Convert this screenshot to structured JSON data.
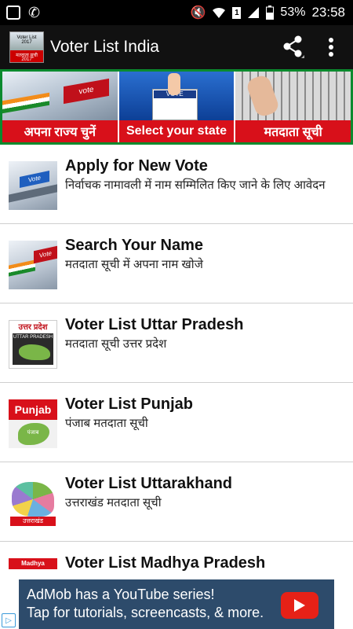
{
  "status_bar": {
    "battery": "53%",
    "time": "23:58"
  },
  "app_bar": {
    "title": "Voter List India",
    "logo_line1": "Voter List 2017",
    "logo_line2": "मतदाता सूची",
    "logo_line3": "2017"
  },
  "banner": [
    {
      "label": "अपना  राज्य  चुनें"
    },
    {
      "label": "Select your state",
      "img_text": "VOTE"
    },
    {
      "label": "मतदाता सूची"
    }
  ],
  "items": [
    {
      "title": "Apply for New Vote",
      "subtitle": "निर्वाचक नामावली में नाम सम्मिलित किए जाने के लिए आवेदन",
      "thumb_text": "Vote"
    },
    {
      "title": "Search Your Name",
      "subtitle": "मतदाता सूची में अपना नाम खोजे",
      "thumb_text": "Vote"
    },
    {
      "title": "Voter List Uttar Pradesh",
      "subtitle": "मतदाता सूची उत्तर प्रदेश",
      "thumb_top": "उत्तर प्रदेश",
      "thumb_mid": "UTTAR PRADESH"
    },
    {
      "title": "Voter List Punjab",
      "subtitle": "पंजाब मतदाता सूची",
      "thumb_top": "Punjab",
      "thumb_mid": "पंजाब"
    },
    {
      "title": "Voter List Uttarakhand",
      "subtitle": "उत्तराखंड  मतदाता सूची",
      "thumb_top": "",
      "thumb_mid": "उत्तराखंड"
    },
    {
      "title": "Voter List Madhya Pradesh",
      "subtitle": "",
      "thumb_top": "Madhya Pradesh",
      "thumb_mid": ""
    }
  ],
  "ad": {
    "line1": "AdMob has a YouTube series!",
    "line2": "Tap for tutorials, screencasts, & more."
  },
  "colors": {
    "banner_red": "#d8101a",
    "banner_border": "#0b8a2e",
    "ad_bg": "#2d4b6b",
    "youtube_red": "#e62117"
  },
  "icons": [
    "mute-icon",
    "wifi-icon",
    "sim-icon",
    "signal-icon",
    "battery-icon",
    "share-icon",
    "overflow-menu-icon",
    "youtube-play-icon",
    "ad-choices-icon"
  ]
}
